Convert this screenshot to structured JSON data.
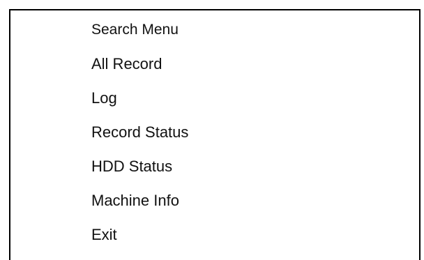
{
  "menu": {
    "title": "Search Menu",
    "items": [
      {
        "label": "All Record"
      },
      {
        "label": "Log"
      },
      {
        "label": "Record Status"
      },
      {
        "label": "HDD Status"
      },
      {
        "label": "Machine Info"
      },
      {
        "label": "Exit"
      }
    ]
  },
  "colors": {
    "background": "#ffffff",
    "border": "#000000",
    "text": "#111111"
  }
}
